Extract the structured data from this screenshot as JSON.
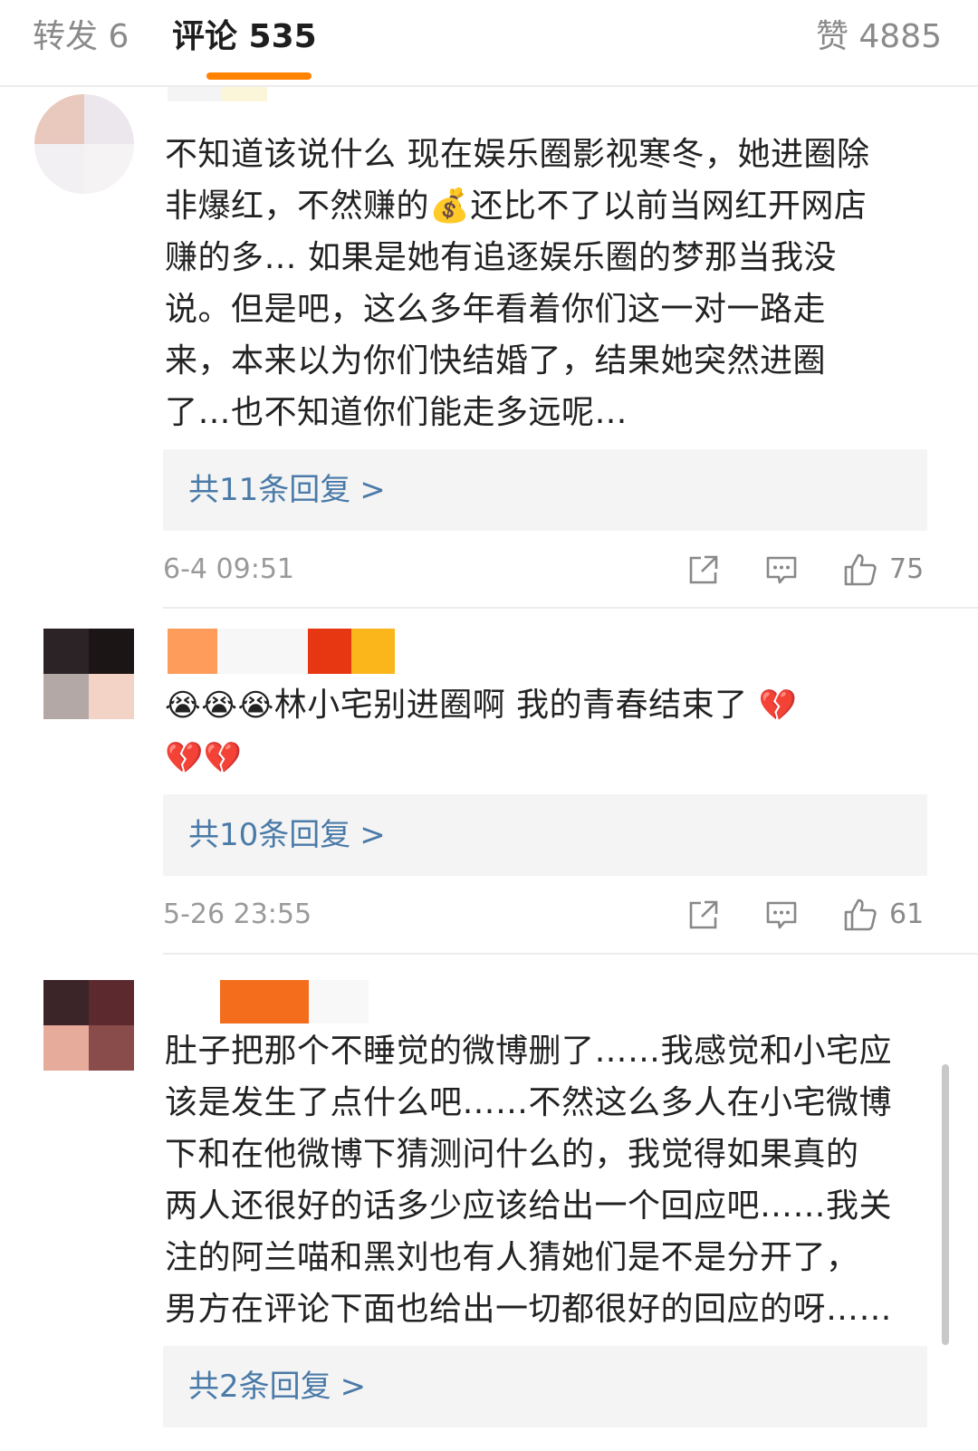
{
  "tabs": {
    "repost": "转发 6",
    "comments": "评论 535",
    "likes": "赞 4885"
  },
  "comments": [
    {
      "text": "不知道该说什么 现在娱乐圈影视寒冬，她进圈除\n非爆红，不然赚的💰还比不了以前当网红开网店\n赚的多… 如果是她有追逐娱乐圈的梦那当我没\n说。但是吧，这么多年看着你们这一对一路走\n来，本来以为你们快结婚了，结果她突然进圈\n了…也不知道你们能走多远呢…",
      "replies_label": "共11条回复",
      "timestamp": "6-4 09:51",
      "likes": "75"
    },
    {
      "text_emoji_prefix": "😭😭😭",
      "text": "林小宅别进圈啊 我的青春结束了",
      "text_emoji_suffix": "💔\n💔💔",
      "replies_label": "共10条回复",
      "timestamp": "5-26 23:55",
      "likes": "61"
    },
    {
      "text": "肚子把那个不睡觉的微博删了……我感觉和小宅应\n该是发生了点什么吧……不然这么多人在小宅微博\n下和在他微博下猜测问什么的，我觉得如果真的\n两人还很好的话多少应该给出一个回应吧……我关\n注的阿兰喵和黑刘也有人猜她们是不是分开了，\n男方在评论下面也给出一切都很好的回应的呀……",
      "replies_label": "共2条回复"
    }
  ],
  "chevron": ">",
  "icons": {
    "share": "share-icon",
    "reply": "comment-icon",
    "like": "thumbs-up-icon"
  },
  "colors": {
    "accent": "#ff8200",
    "link": "#4a7aa8",
    "muted": "#9a9a9a"
  }
}
